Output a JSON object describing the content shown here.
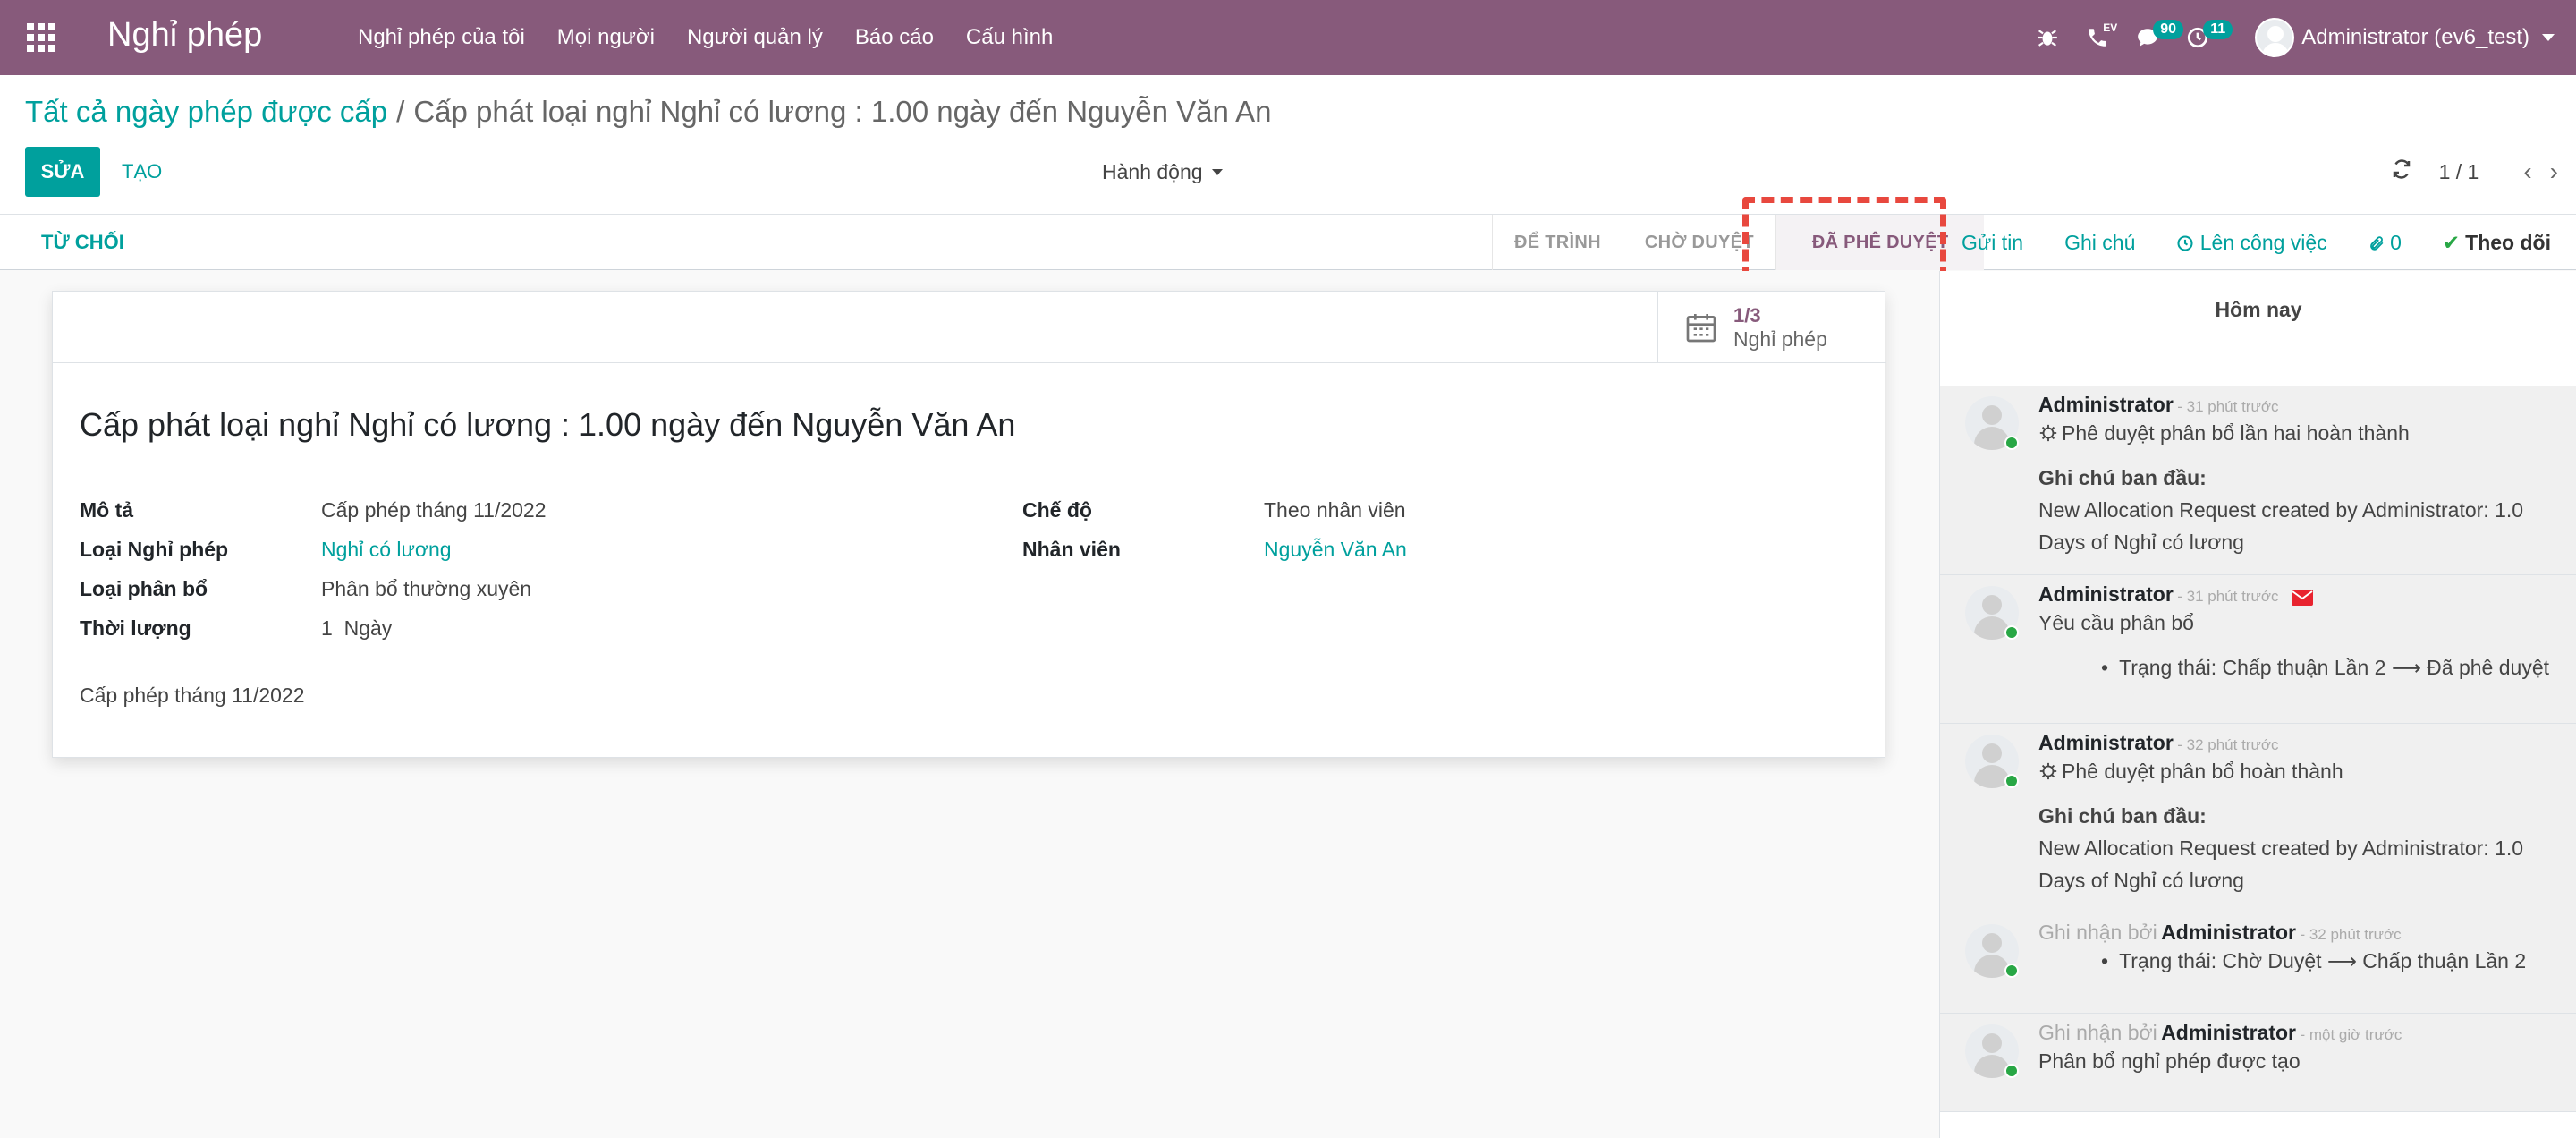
{
  "navbar": {
    "brand": "Nghỉ phép",
    "menu": [
      "Nghỉ phép của tôi",
      "Mọi người",
      "Người quản lý",
      "Báo cáo",
      "Cấu hình"
    ],
    "ev_tag": "EV",
    "messages_count": "90",
    "activities_count": "11",
    "user_name": "Administrator (ev6_test)"
  },
  "breadcrumb": {
    "parent": "Tất cả ngày phép được cấp",
    "separator": "/",
    "current": "Cấp phát loại nghỉ Nghỉ có lương : 1.00 ngày đến Nguyễn Văn An"
  },
  "buttons": {
    "edit": "SỬA",
    "create": "TẠO",
    "action": "Hành động"
  },
  "pager": {
    "value": "1 / 1"
  },
  "statusbar": {
    "reject": "TỪ CHỐI",
    "states": [
      "ĐỂ TRÌNH",
      "CHỜ DUYỆT",
      "ĐÃ PHÊ DUYỆT"
    ],
    "active_state": "ĐÃ PHÊ DUYỆT"
  },
  "chatter_top": {
    "send_message": "Gửi tin",
    "log_note": "Ghi chú",
    "schedule_activity": "Lên công việc",
    "attachments": "0",
    "follow": "Theo dõi"
  },
  "stat_button": {
    "value": "1/3",
    "label": "Nghỉ phép"
  },
  "form": {
    "title": "Cấp phát loại nghỉ Nghỉ có lương : 1.00 ngày đến Nguyễn Văn An",
    "left": [
      {
        "label": "Mô tả",
        "value": "Cấp phép tháng 11/2022",
        "link": false
      },
      {
        "label": "Loại Nghỉ phép",
        "value": "Nghỉ có lương",
        "link": true
      },
      {
        "label": "Loại phân bổ",
        "value": "Phân bổ thường xuyên",
        "link": false
      },
      {
        "label": "Thời lượng",
        "value": "1  Ngày",
        "link": false
      }
    ],
    "right": [
      {
        "label": "Chế độ",
        "value": "Theo nhân viên",
        "link": false
      },
      {
        "label": "Nhân viên",
        "value": "Nguyễn Văn An",
        "link": true
      }
    ],
    "notes": "Cấp phép tháng 11/2022"
  },
  "chatter": {
    "today": "Hôm nay",
    "messages": [
      {
        "author": "Administrator",
        "time": "- 31 phút trước",
        "subtype": "Phê duyệt phân bổ lần hai hoàn thành",
        "note_label": "Ghi chú ban đầu:",
        "note_lines": [
          "New Allocation Request created by Administrator: 1.0",
          "Days of Nghỉ có lương"
        ]
      },
      {
        "author": "Administrator",
        "time": "- 31 phút trước",
        "text": "Yêu cầu phân bổ",
        "bullet": "Trạng thái: Chấp thuận Lần 2 ⟶ Đã phê duyệt"
      },
      {
        "author": "Administrator",
        "time": "- 32 phút trước",
        "subtype": "Phê duyệt phân bổ hoàn thành",
        "note_label": "Ghi chú ban đầu:",
        "note_lines": [
          "New Allocation Request created by Administrator: 1.0",
          "Days of Nghỉ có lương"
        ]
      },
      {
        "prefix": "Ghi nhận bởi",
        "author": "Administrator",
        "time": "- 32 phút trước",
        "bullet": "Trạng thái: Chờ Duyệt ⟶ Chấp thuận Lần 2"
      },
      {
        "prefix": "Ghi nhận bởi",
        "author": "Administrator",
        "time": "- một giờ trước",
        "text": "Phân bổ nghỉ phép được tạo"
      }
    ]
  },
  "colors": {
    "navbar": "#875a7b",
    "primary": "#00a09d",
    "highlight": "#e8483e"
  }
}
